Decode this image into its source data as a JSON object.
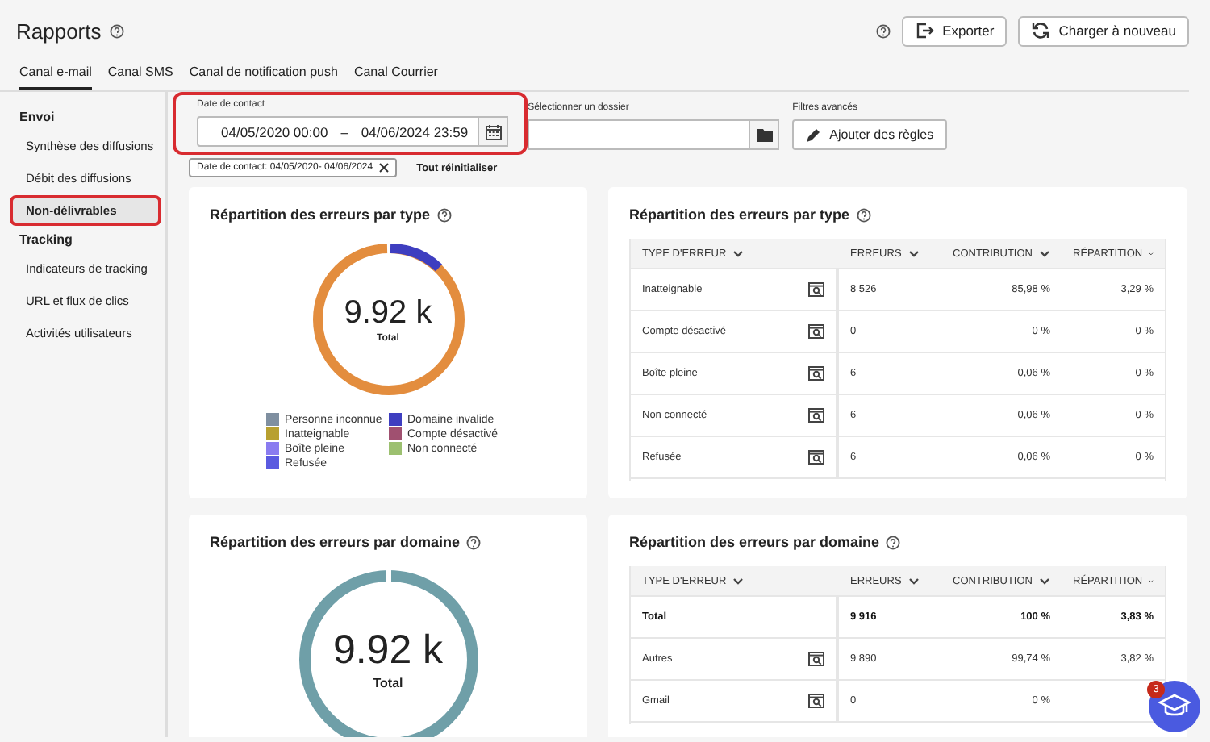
{
  "header": {
    "title": "Rapports",
    "buttons": [
      {
        "label": "Exporter",
        "kind": "export"
      },
      {
        "label": "Charger à nouveau",
        "kind": "reload"
      }
    ]
  },
  "tabs": [
    {
      "label": "Canal e-mail",
      "selected": true
    },
    {
      "label": "Canal SMS",
      "selected": false
    },
    {
      "label": "Canal de notification push",
      "selected": false
    },
    {
      "label": "Canal Courrier",
      "selected": false
    }
  ],
  "sidebar": [
    {
      "title": "Envoi",
      "items": [
        {
          "label": "Synthèse des diffusions",
          "selected": false,
          "highlighted": false
        },
        {
          "label": "Débit des diffusions",
          "selected": false,
          "highlighted": false
        },
        {
          "label": "Non-délivrables",
          "selected": true,
          "highlighted": true
        }
      ]
    },
    {
      "title": "Tracking",
      "items": [
        {
          "label": "Indicateurs de tracking",
          "selected": false,
          "highlighted": false
        },
        {
          "label": "URL et flux de clics",
          "selected": false,
          "highlighted": false
        },
        {
          "label": "Activités utilisateurs",
          "selected": false,
          "highlighted": false
        }
      ]
    }
  ],
  "filters": {
    "date": {
      "label": "Date de contact",
      "start": "04/05/2020 00:00",
      "separator": "–",
      "end": "04/06/2024 23:59",
      "highlighted": true
    },
    "folder": {
      "label": "Sélectionner un dossier"
    },
    "advanced": {
      "label": "Filtres avancés",
      "button": "Ajouter des règles"
    },
    "chips": [
      {
        "label": "Date de contact: 04/05/2020- 04/06/2024"
      }
    ],
    "reset": "Tout réinitialiser"
  },
  "panels": [
    {
      "kind": "donut",
      "title": "Répartition des erreurs par type",
      "total": "9.92 k",
      "total_label": "Total",
      "legend": [
        {
          "label": "Personne inconnue",
          "color": "#7f8fa0"
        },
        {
          "label": "Domaine invalide",
          "color": "#3e3ec0"
        },
        {
          "label": "Inatteignable",
          "color": "#b8a030"
        },
        {
          "label": "Compte désactivé",
          "color": "#a05070"
        },
        {
          "label": "Boîte pleine",
          "color": "#8a7cf0"
        },
        {
          "label": "Non connecté",
          "color": "#9cc070"
        },
        {
          "label": "Refusée",
          "color": "#5a5ae0"
        }
      ]
    },
    {
      "kind": "table",
      "title": "Répartition des erreurs par type",
      "columns": [
        "TYPE D'ERREUR",
        "ERREURS",
        "CONTRIBUTION",
        "RÉPARTITION"
      ],
      "rows": [
        {
          "kind": "item",
          "cells": [
            "Inatteignable",
            "8 526",
            "85,98 %",
            "3,29 %"
          ]
        },
        {
          "kind": "item",
          "cells": [
            "Compte désactivé",
            "0",
            "0 %",
            "0 %"
          ]
        },
        {
          "kind": "item",
          "cells": [
            "Boîte pleine",
            "6",
            "0,06 %",
            "0 %"
          ]
        },
        {
          "kind": "item",
          "cells": [
            "Non connecté",
            "6",
            "0,06 %",
            "0 %"
          ]
        },
        {
          "kind": "item",
          "cells": [
            "Refusée",
            "6",
            "0,06 %",
            "0 %"
          ]
        }
      ]
    },
    {
      "kind": "donut",
      "title": "Répartition des erreurs par domaine",
      "total": "9.92 k",
      "total_label": "Total"
    },
    {
      "kind": "table",
      "title": "Répartition des erreurs par domaine",
      "columns": [
        "TYPE D'ERREUR",
        "ERREURS",
        "CONTRIBUTION",
        "RÉPARTITION"
      ],
      "rows": [
        {
          "kind": "total",
          "cells": [
            "Total",
            "9 916",
            "100 %",
            "3,83 %"
          ]
        },
        {
          "kind": "item",
          "cells": [
            "Autres",
            "9 890",
            "99,74 %",
            "3,82 %"
          ]
        },
        {
          "kind": "item",
          "cells": [
            "Gmail",
            "0",
            "0 %"
          ]
        }
      ]
    }
  ],
  "help_button": {
    "badge": "3"
  }
}
